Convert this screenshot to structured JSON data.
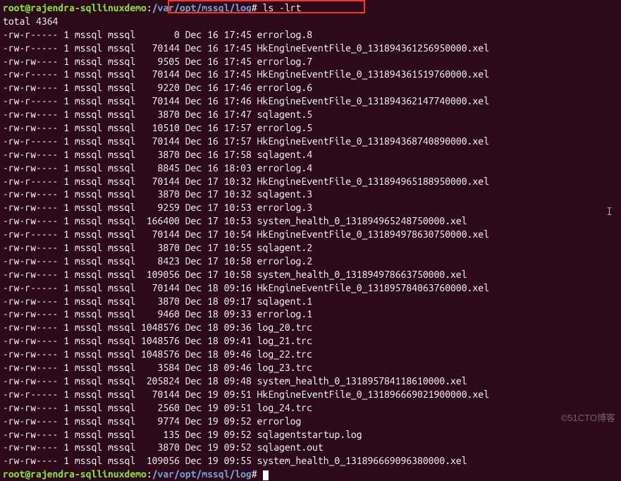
{
  "prompt": {
    "user_host": "root@rajendra-sqllinuxdemo",
    "separator": ":",
    "path": "/var/opt/mssql/log",
    "symbol": "#",
    "command": "ls -lrt"
  },
  "total_line": "total 4364",
  "files": [
    {
      "perms": "-rw-r-----",
      "links": "1",
      "owner": "mssql",
      "group": "mssql",
      "size": "0",
      "date": "Dec 16 17:45",
      "name": "errorlog.8"
    },
    {
      "perms": "-rw-r-----",
      "links": "1",
      "owner": "mssql",
      "group": "mssql",
      "size": "70144",
      "date": "Dec 16 17:45",
      "name": "HkEngineEventFile_0_131894361256950000.xel"
    },
    {
      "perms": "-rw-rw----",
      "links": "1",
      "owner": "mssql",
      "group": "mssql",
      "size": "9505",
      "date": "Dec 16 17:45",
      "name": "errorlog.7"
    },
    {
      "perms": "-rw-r-----",
      "links": "1",
      "owner": "mssql",
      "group": "mssql",
      "size": "70144",
      "date": "Dec 16 17:45",
      "name": "HkEngineEventFile_0_131894361519760000.xel"
    },
    {
      "perms": "-rw-rw----",
      "links": "1",
      "owner": "mssql",
      "group": "mssql",
      "size": "9220",
      "date": "Dec 16 17:46",
      "name": "errorlog.6"
    },
    {
      "perms": "-rw-r-----",
      "links": "1",
      "owner": "mssql",
      "group": "mssql",
      "size": "70144",
      "date": "Dec 16 17:46",
      "name": "HkEngineEventFile_0_131894362147740000.xel"
    },
    {
      "perms": "-rw-rw----",
      "links": "1",
      "owner": "mssql",
      "group": "mssql",
      "size": "3870",
      "date": "Dec 16 17:47",
      "name": "sqlagent.5"
    },
    {
      "perms": "-rw-rw----",
      "links": "1",
      "owner": "mssql",
      "group": "mssql",
      "size": "10510",
      "date": "Dec 16 17:57",
      "name": "errorlog.5"
    },
    {
      "perms": "-rw-r-----",
      "links": "1",
      "owner": "mssql",
      "group": "mssql",
      "size": "70144",
      "date": "Dec 16 17:57",
      "name": "HkEngineEventFile_0_131894368740890000.xel"
    },
    {
      "perms": "-rw-rw----",
      "links": "1",
      "owner": "mssql",
      "group": "mssql",
      "size": "3870",
      "date": "Dec 16 17:58",
      "name": "sqlagent.4"
    },
    {
      "perms": "-rw-rw----",
      "links": "1",
      "owner": "mssql",
      "group": "mssql",
      "size": "8845",
      "date": "Dec 16 18:03",
      "name": "errorlog.4"
    },
    {
      "perms": "-rw-r-----",
      "links": "1",
      "owner": "mssql",
      "group": "mssql",
      "size": "70144",
      "date": "Dec 17 10:32",
      "name": "HkEngineEventFile_0_131894965188950000.xel"
    },
    {
      "perms": "-rw-rw----",
      "links": "1",
      "owner": "mssql",
      "group": "mssql",
      "size": "3870",
      "date": "Dec 17 10:32",
      "name": "sqlagent.3"
    },
    {
      "perms": "-rw-rw----",
      "links": "1",
      "owner": "mssql",
      "group": "mssql",
      "size": "9259",
      "date": "Dec 17 10:53",
      "name": "errorlog.3"
    },
    {
      "perms": "-rw-rw----",
      "links": "1",
      "owner": "mssql",
      "group": "mssql",
      "size": "166400",
      "date": "Dec 17 10:53",
      "name": "system_health_0_131894965248750000.xel"
    },
    {
      "perms": "-rw-r-----",
      "links": "1",
      "owner": "mssql",
      "group": "mssql",
      "size": "70144",
      "date": "Dec 17 10:54",
      "name": "HkEngineEventFile_0_131894978630750000.xel"
    },
    {
      "perms": "-rw-rw----",
      "links": "1",
      "owner": "mssql",
      "group": "mssql",
      "size": "3870",
      "date": "Dec 17 10:55",
      "name": "sqlagent.2"
    },
    {
      "perms": "-rw-rw----",
      "links": "1",
      "owner": "mssql",
      "group": "mssql",
      "size": "8423",
      "date": "Dec 17 10:58",
      "name": "errorlog.2"
    },
    {
      "perms": "-rw-rw----",
      "links": "1",
      "owner": "mssql",
      "group": "mssql",
      "size": "109056",
      "date": "Dec 17 10:58",
      "name": "system_health_0_131894978663750000.xel"
    },
    {
      "perms": "-rw-r-----",
      "links": "1",
      "owner": "mssql",
      "group": "mssql",
      "size": "70144",
      "date": "Dec 18 09:16",
      "name": "HkEngineEventFile_0_131895784063760000.xel"
    },
    {
      "perms": "-rw-rw----",
      "links": "1",
      "owner": "mssql",
      "group": "mssql",
      "size": "3870",
      "date": "Dec 18 09:17",
      "name": "sqlagent.1"
    },
    {
      "perms": "-rw-rw----",
      "links": "1",
      "owner": "mssql",
      "group": "mssql",
      "size": "9460",
      "date": "Dec 18 09:33",
      "name": "errorlog.1"
    },
    {
      "perms": "-rw-rw----",
      "links": "1",
      "owner": "mssql",
      "group": "mssql",
      "size": "1048576",
      "date": "Dec 18 09:36",
      "name": "log_20.trc"
    },
    {
      "perms": "-rw-rw----",
      "links": "1",
      "owner": "mssql",
      "group": "mssql",
      "size": "1048576",
      "date": "Dec 18 09:41",
      "name": "log_21.trc"
    },
    {
      "perms": "-rw-rw----",
      "links": "1",
      "owner": "mssql",
      "group": "mssql",
      "size": "1048576",
      "date": "Dec 18 09:46",
      "name": "log_22.trc"
    },
    {
      "perms": "-rw-rw----",
      "links": "1",
      "owner": "mssql",
      "group": "mssql",
      "size": "3584",
      "date": "Dec 18 09:46",
      "name": "log_23.trc"
    },
    {
      "perms": "-rw-rw----",
      "links": "1",
      "owner": "mssql",
      "group": "mssql",
      "size": "205824",
      "date": "Dec 18 09:48",
      "name": "system_health_0_131895784118610000.xel"
    },
    {
      "perms": "-rw-r-----",
      "links": "1",
      "owner": "mssql",
      "group": "mssql",
      "size": "70144",
      "date": "Dec 19 09:51",
      "name": "HkEngineEventFile_0_131896669021900000.xel"
    },
    {
      "perms": "-rw-rw----",
      "links": "1",
      "owner": "mssql",
      "group": "mssql",
      "size": "2560",
      "date": "Dec 19 09:51",
      "name": "log_24.trc"
    },
    {
      "perms": "-rw-rw----",
      "links": "1",
      "owner": "mssql",
      "group": "mssql",
      "size": "9774",
      "date": "Dec 19 09:52",
      "name": "errorlog"
    },
    {
      "perms": "-rw-rw----",
      "links": "1",
      "owner": "mssql",
      "group": "mssql",
      "size": "135",
      "date": "Dec 19 09:52",
      "name": "sqlagentstartup.log"
    },
    {
      "perms": "-rw-rw----",
      "links": "1",
      "owner": "mssql",
      "group": "mssql",
      "size": "3870",
      "date": "Dec 19 09:52",
      "name": "sqlagent.out"
    },
    {
      "perms": "-rw-rw----",
      "links": "1",
      "owner": "mssql",
      "group": "mssql",
      "size": "109056",
      "date": "Dec 19 09:55",
      "name": "system_health_0_131896669096380000.xel"
    }
  ],
  "watermark": "©51CTO博客"
}
